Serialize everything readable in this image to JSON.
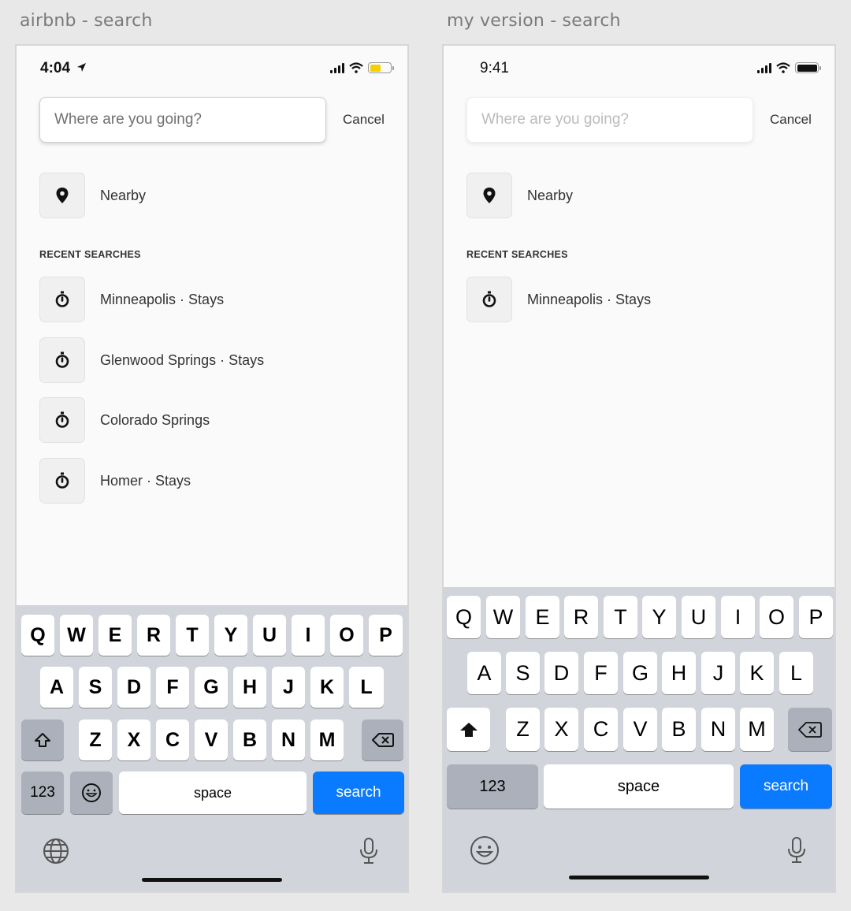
{
  "captions": {
    "left": "airbnb - search",
    "right": "my version - search"
  },
  "left": {
    "time": "4:04",
    "search_placeholder": "Where are you going?",
    "cancel": "Cancel",
    "nearby": "Nearby",
    "section_title": "RECENT SEARCHES",
    "recent": [
      "Minneapolis · Stays",
      "Glenwood Springs · Stays",
      "Colorado Springs",
      "Homer · Stays"
    ],
    "keyboard": {
      "row1": [
        "Q",
        "W",
        "E",
        "R",
        "T",
        "Y",
        "U",
        "I",
        "O",
        "P"
      ],
      "row2": [
        "A",
        "S",
        "D",
        "F",
        "G",
        "H",
        "J",
        "K",
        "L"
      ],
      "row3": [
        "Z",
        "X",
        "C",
        "V",
        "B",
        "N",
        "M"
      ],
      "numbers": "123",
      "space": "space",
      "search": "search"
    }
  },
  "right": {
    "time": "9:41",
    "search_placeholder": "Where are you going?",
    "cancel": "Cancel",
    "nearby": "Nearby",
    "section_title": "RECENT SEARCHES",
    "recent": [
      "Minneapolis · Stays"
    ],
    "keyboard": {
      "row1": [
        "Q",
        "W",
        "E",
        "R",
        "T",
        "Y",
        "U",
        "I",
        "O",
        "P"
      ],
      "row2": [
        "A",
        "S",
        "D",
        "F",
        "G",
        "H",
        "J",
        "K",
        "L"
      ],
      "row3": [
        "Z",
        "X",
        "C",
        "V",
        "B",
        "N",
        "M"
      ],
      "numbers": "123",
      "space": "space",
      "search": "search"
    }
  },
  "colors": {
    "accent": "#0a7aff",
    "battery_charging": "#f5d000",
    "background": "#e8e8e8"
  },
  "icons": {
    "nearby": "location-pin-icon",
    "recent": "recent-history-icon",
    "shift": "shift-arrow-icon",
    "delete": "backspace-icon",
    "emoji": "emoji-icon",
    "globe": "globe-icon",
    "mic": "microphone-icon"
  }
}
